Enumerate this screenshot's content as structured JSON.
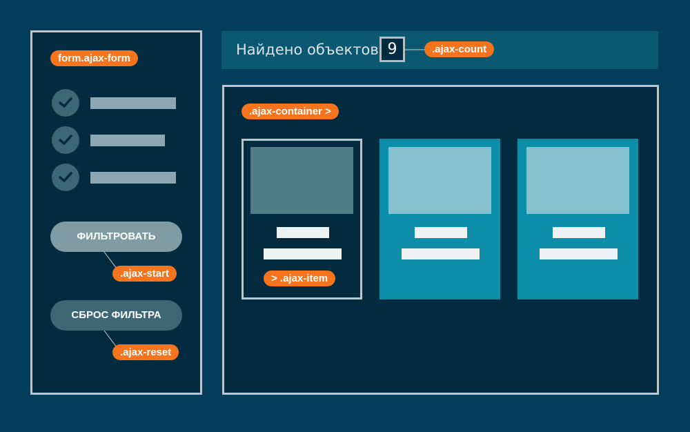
{
  "form_panel": {
    "tag": "form.ajax-form",
    "filter_button": "ФИЛЬТРОВАТЬ",
    "filter_tag": ".ajax-start",
    "reset_button": "СБРОС ФИЛЬТРА",
    "reset_tag": ".ajax-reset"
  },
  "count_bar": {
    "label": "Найдено объектов:",
    "value": "9",
    "tag": ".ajax-count"
  },
  "container_panel": {
    "tag": ".ajax-container >",
    "item_tag": "> .ajax-item"
  },
  "colors": {
    "background": "#033d5c",
    "panel": "#022b40",
    "accent_tag": "#f7741e",
    "card": "#0c8ea9"
  },
  "icons": [
    "checkmark-icon"
  ]
}
